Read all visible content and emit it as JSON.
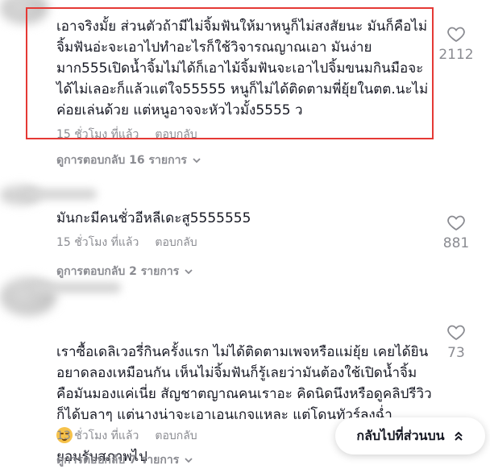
{
  "comments": [
    {
      "text": "เอาจริงมั้ย ส่วนตัวถ้ามีไม่จิ้มฟันให้มาหนูก็ไม่สงสัยนะ มันก็คือไม่จิ้มฟันอ่ะจะเอาไปทำอะไรก็ใช้วิจารณญาณเอา มันง่ายมาก555เปิดน้ำจิ้มไม่ได้ก็เอาไม้จิ้มฟันจะเอาไปจิ้มขนมกินมือจะได้ไม่เลอะก็แล้วแต่ใจ55555 หนูก็ไม่ได้ติดตามพี่ยุ้ยในตต.นะไม่ค่อยเล่นด้วย แต่หนูอาจจะหัวไวมั้ง5555 ว",
      "time": "15 ชั่วโมง ที่แล้ว",
      "reply_label": "ตอบกลับ",
      "view_replies": "ดูการตอบกลับ 16 รายการ",
      "likes": "2112"
    },
    {
      "text": "มันกะมีคนชั่วอีหลีเดะสู5555555",
      "time": "15 ชั่วโมง ที่แล้ว",
      "reply_label": "ตอบกลับ",
      "view_replies": "ดูการตอบกลับ 2 รายการ",
      "likes": "881"
    },
    {
      "text_before_emoji": "เราซื้อเดลิเวอรี่กินครั้งแรก ไม่ได้ติดตามเพจหรือแม่ยุ้ย เคยได้ยินอยาดลองเหมือนกัน เห็นไม่จิ้มฟันก็รู้เลยว่ามันต้องใช้เปิดน้ำจิ้ม คือมันมองแค่เนี่ย สัญชาตญาณคนเราอะ คิดนิดนึงหรือดูคลิปรีวิวก็ได้บลาๆ แต่นางน่าจะเอาเอนเกจแหละ แต่โดนทัวร์ลงฉ่ำ",
      "text_after_emoji": "ยอมรับสภาพไป",
      "emoji_icon": "relieved-face-emoji",
      "time": "13 ชั่วโมง ที่แล้ว",
      "reply_label": "ตอบกลับ",
      "view_replies": "ดูการตอบกลับ 7 รายการ",
      "likes": "73"
    }
  ],
  "back_to_top": {
    "label": "กลับไปที่ส่วนบน",
    "icon": "double-chevron-up-icon"
  },
  "colors": {
    "highlight": "#e53935",
    "meta": "#8a8b91",
    "text": "#161823"
  }
}
